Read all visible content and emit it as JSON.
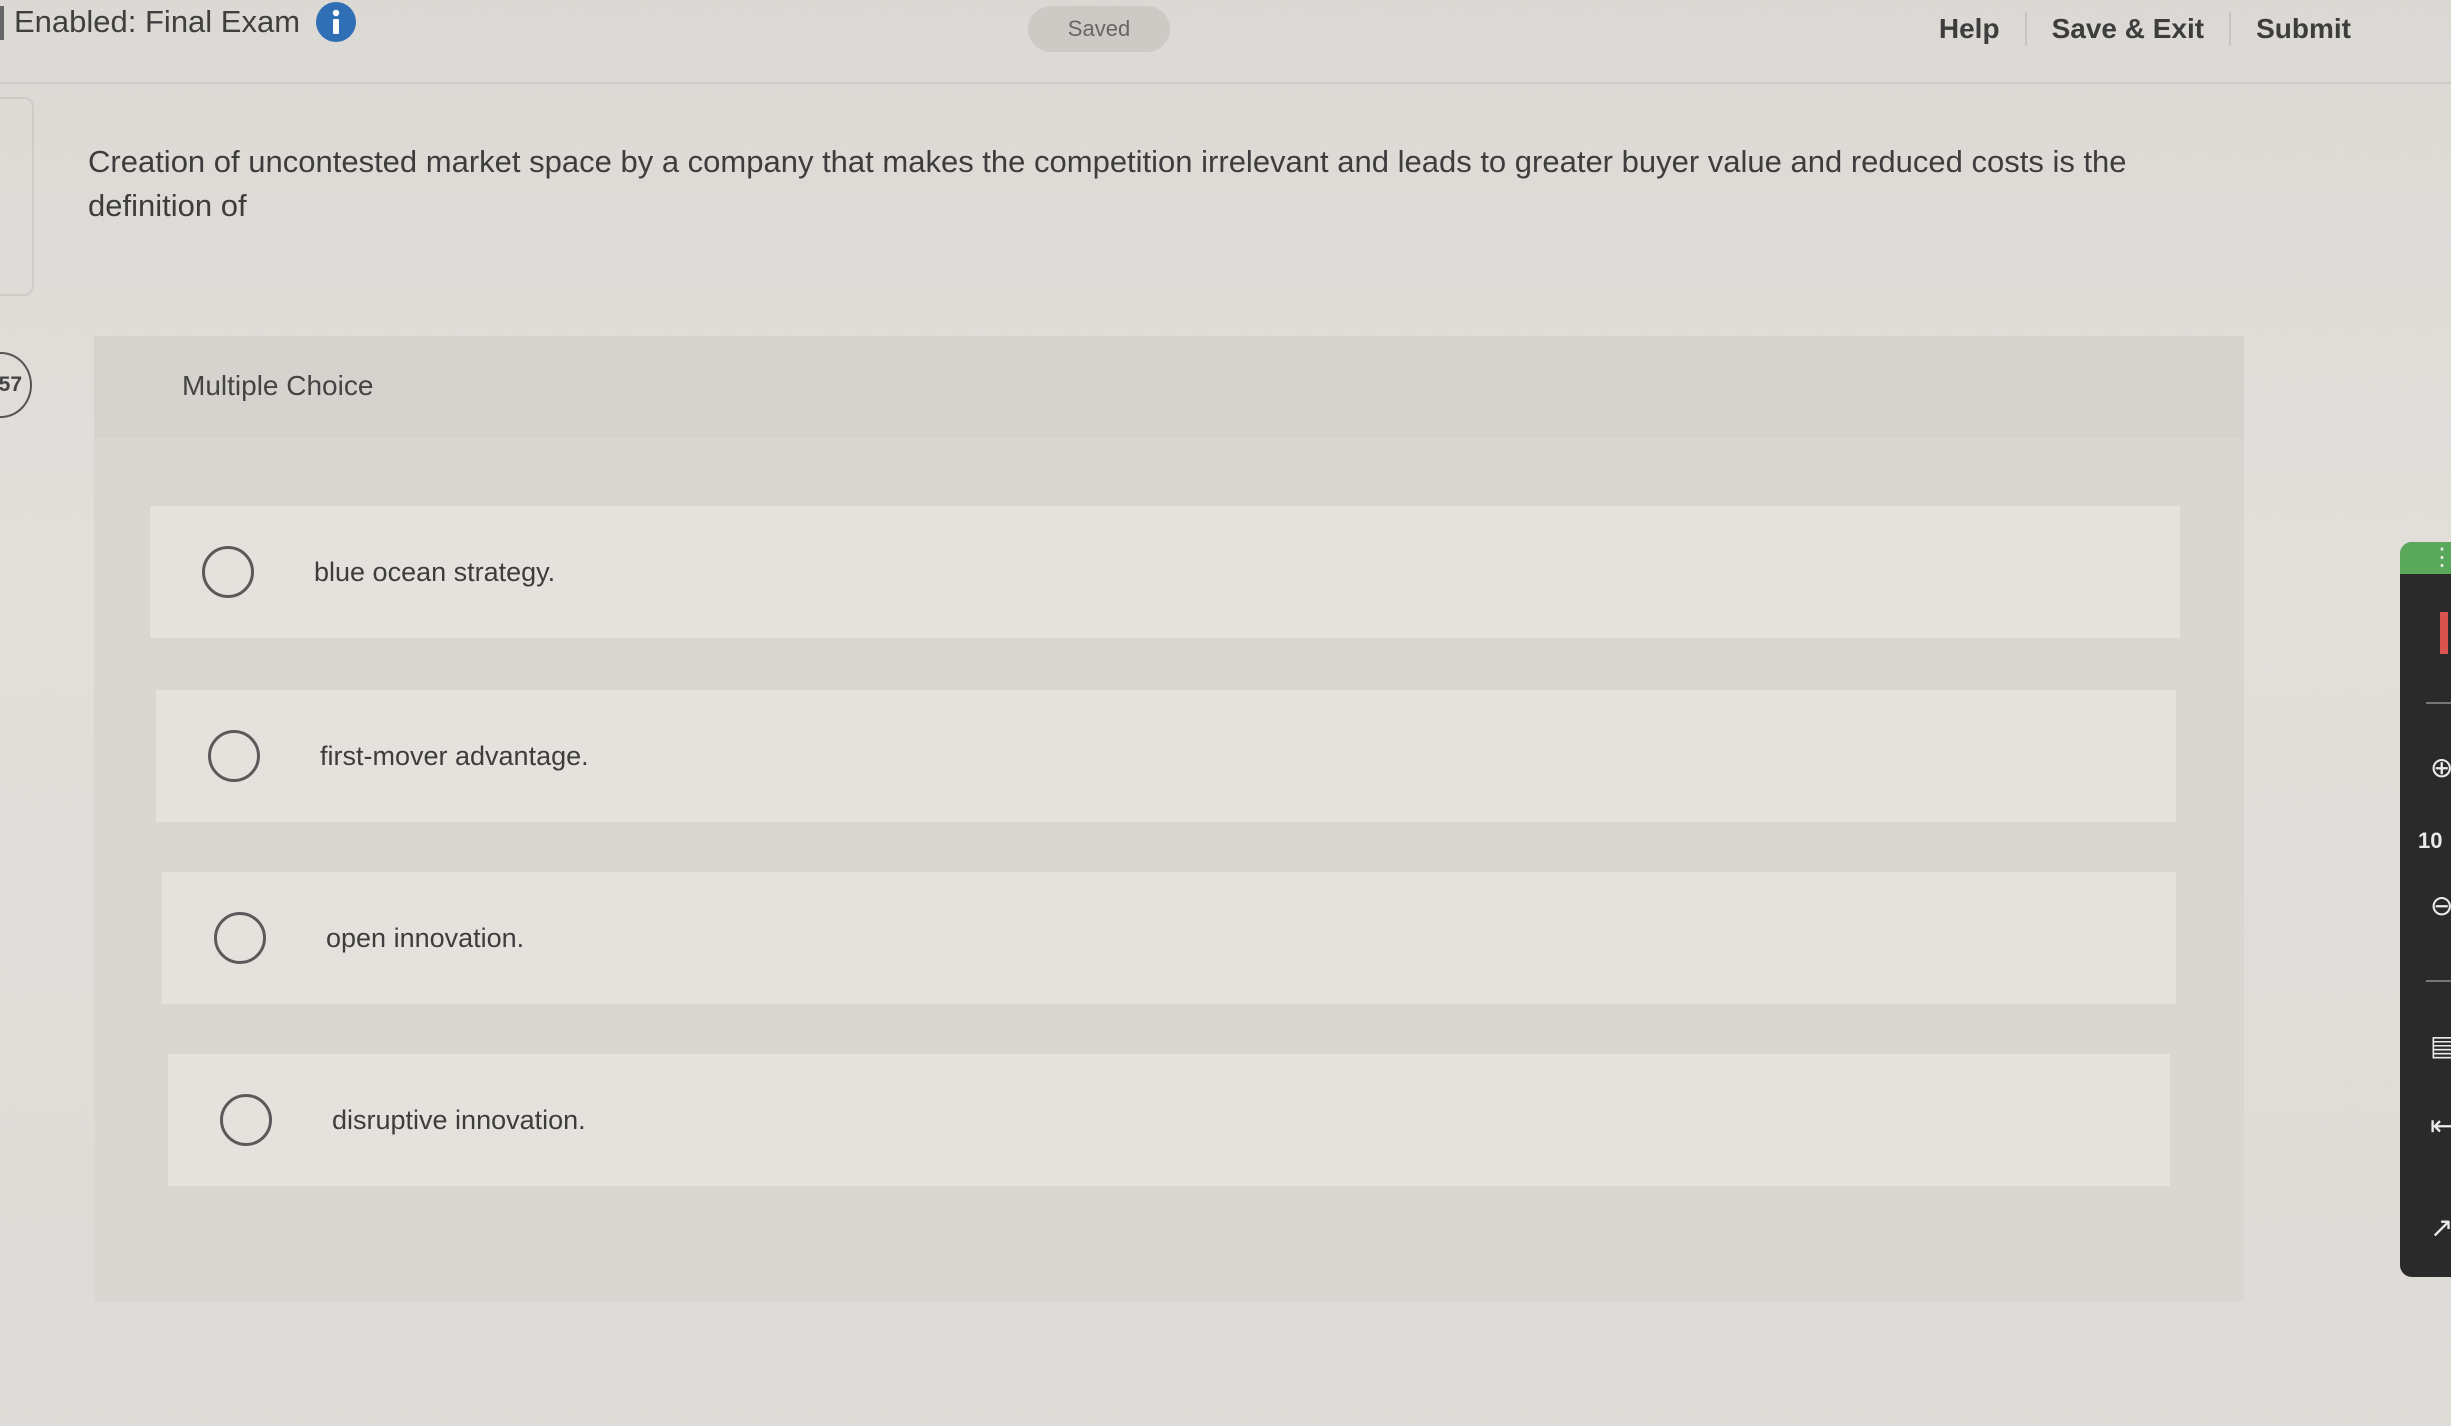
{
  "header": {
    "exam_title": "Enabled: Final Exam",
    "saved_badge": "Saved",
    "nav": [
      "Help",
      "Save & Exit",
      "Submit"
    ]
  },
  "question": {
    "number": "57",
    "text": "Creation of uncontested market space by a company that makes the competition irrelevant and leads to greater buyer value and reduced costs is the definition of"
  },
  "multiple_choice": {
    "label": "Multiple Choice",
    "options": [
      "blue ocean strategy.",
      "first-mover advantage.",
      "open innovation.",
      "disruptive innovation."
    ]
  },
  "right_toolbar": {
    "zoom": "10",
    "icons": [
      "more-options-icon",
      "zoom-in-icon",
      "zoom-out-icon",
      "comment-icon",
      "collapse-icon",
      "expand-icon"
    ]
  },
  "colors": {
    "info_icon": "#2f6fb5",
    "toolbar_bg": "#2a2a2a",
    "toolbar_accent": "#5aa85a",
    "toolbar_marker": "#d9534f"
  }
}
